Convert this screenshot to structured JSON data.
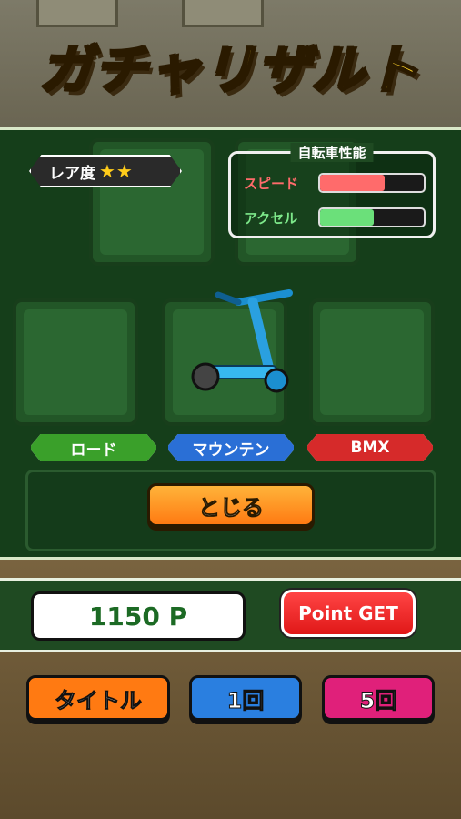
{
  "title": "ガチャリザルト",
  "rarity": {
    "label": "レア度",
    "stars": "★★"
  },
  "performance": {
    "title": "自転車性能",
    "stats": [
      {
        "label": "スピード",
        "level": 0.62,
        "color": "#ff6b6b",
        "label_color": "#ff6b6b"
      },
      {
        "label": "アクセル",
        "level": 0.52,
        "color": "#6be07a",
        "label_color": "#7de88a"
      }
    ]
  },
  "categories": [
    {
      "label": "ロード",
      "color": "#3aa02a"
    },
    {
      "label": "マウンテン",
      "color": "#2a6fd6"
    },
    {
      "label": "BMX",
      "color": "#d62a2a"
    }
  ],
  "close_button": {
    "label": "とじる"
  },
  "points": {
    "value": "1150 P"
  },
  "point_get_button": {
    "label": "Point GET"
  },
  "bottom_buttons": [
    {
      "label": "タイトル",
      "color": "#ff7a12"
    },
    {
      "label": "1回",
      "color": "#2a7fe0"
    },
    {
      "label": "5回",
      "color": "#e0207a"
    }
  ]
}
